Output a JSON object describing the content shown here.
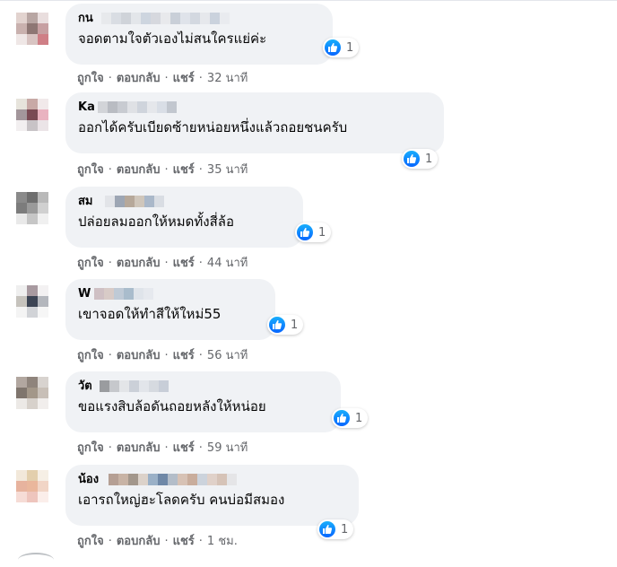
{
  "colors": {
    "bubble": "#f0f2f5",
    "meta_text": "#65676b",
    "like_blue": "#1877f2"
  },
  "comments": [
    {
      "author": "กน",
      "text": "จอดตามใจตัวเองไม่สนใครแย่ค่ะ",
      "reactions": {
        "icon": "like-icon",
        "count": "1"
      },
      "actions": {
        "like": "ถูกใจ",
        "reply": "ตอบกลับ",
        "share": "แชร์",
        "time": "32 นาที"
      }
    },
    {
      "author": "Ka",
      "text": "ออกได้ครับเบียดซ้ายหน่อยหนึ่งแล้วถอยชนครับ",
      "reactions": {
        "icon": "like-icon",
        "count": "1"
      },
      "actions": {
        "like": "ถูกใจ",
        "reply": "ตอบกลับ",
        "share": "แชร์",
        "time": "35 นาที"
      }
    },
    {
      "author": "สม",
      "text": "ปล่อยลมออกให้หมดทั้งสี่ล้อ",
      "reactions": {
        "icon": "like-icon",
        "count": "1"
      },
      "actions": {
        "like": "ถูกใจ",
        "reply": "ตอบกลับ",
        "share": "แชร์",
        "time": "44 นาที"
      }
    },
    {
      "author": "W",
      "text": "เขาจอดให้ทำสีให้ใหม่55",
      "reactions": {
        "icon": "like-icon",
        "count": "1"
      },
      "actions": {
        "like": "ถูกใจ",
        "reply": "ตอบกลับ",
        "share": "แชร์",
        "time": "56 นาที"
      }
    },
    {
      "author": "วัต",
      "text": "ขอแรงสิบล้อดันถอยหลังให้หน่อย",
      "reactions": {
        "icon": "like-icon",
        "count": "1"
      },
      "actions": {
        "like": "ถูกใจ",
        "reply": "ตอบกลับ",
        "share": "แชร์",
        "time": "59 นาที"
      }
    },
    {
      "author": "น้อง",
      "text": "เอารถใหญ่ฮะโลดครับ คนบ่อมีสมอง",
      "reactions": {
        "icon": "like-icon",
        "count": "1"
      },
      "actions": {
        "like": "ถูกใจ",
        "reply": "ตอบกลับ",
        "share": "แชร์",
        "time": "1 ชม."
      }
    }
  ]
}
